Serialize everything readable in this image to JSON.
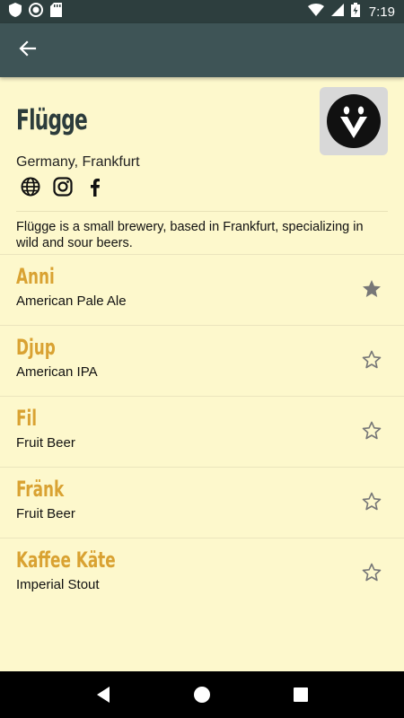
{
  "status_bar": {
    "time": "7:19"
  },
  "brewery": {
    "name": "Flügge",
    "location": "Germany, Frankfurt",
    "description": "Flügge is a small brewery, based in Frankfurt, specializing in wild and sour beers."
  },
  "beers": [
    {
      "name": "Anni",
      "style": "American Pale Ale",
      "favorite": true
    },
    {
      "name": "Djup",
      "style": "American IPA",
      "favorite": false
    },
    {
      "name": "Fil",
      "style": "Fruit Beer",
      "favorite": false
    },
    {
      "name": "Fränk",
      "style": "Fruit Beer",
      "favorite": false
    },
    {
      "name": "Kaffee Käte",
      "style": "Imperial Stout",
      "favorite": false
    }
  ],
  "colors": {
    "app_bar": "#3e5456",
    "status_bar": "#2d3e3e",
    "background": "#fdf8cc",
    "beer_name": "#d9a232",
    "title": "#2c3c3c"
  },
  "icons": [
    "shield-icon",
    "record-icon",
    "sd-card-icon",
    "wifi-icon",
    "signal-icon",
    "battery-icon",
    "back-arrow-icon",
    "globe-icon",
    "instagram-icon",
    "facebook-icon",
    "star-icon",
    "nav-back-icon",
    "nav-home-icon",
    "nav-recents-icon"
  ]
}
